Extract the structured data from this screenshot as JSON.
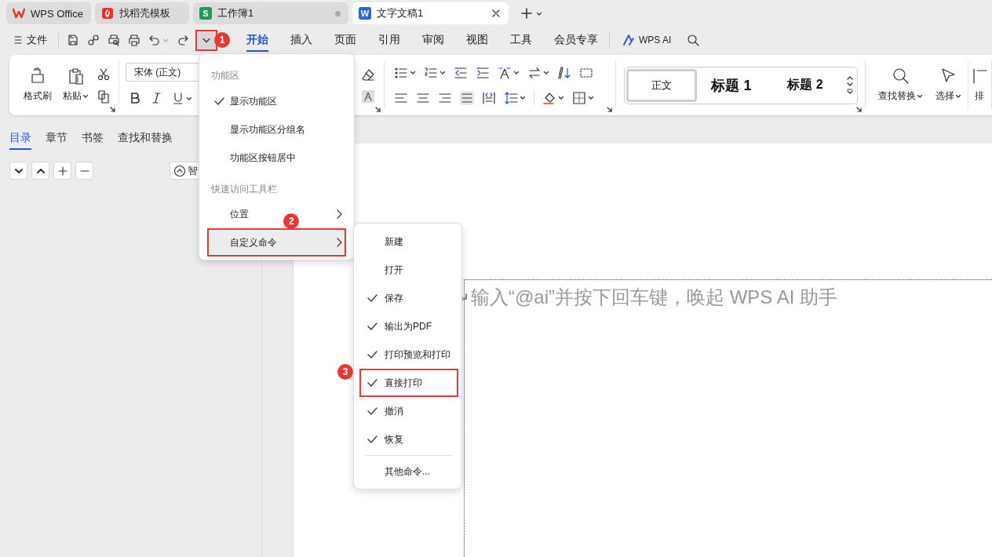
{
  "tabs": [
    {
      "kind": "home",
      "label": "WPS Office",
      "selected": false,
      "modified": false
    },
    {
      "kind": "template",
      "label": "找稻壳模板",
      "selected": false,
      "modified": false
    },
    {
      "kind": "sheet",
      "icon_letter": "S",
      "label": "工作簿1",
      "selected": false,
      "modified": true
    },
    {
      "kind": "writer",
      "icon_letter": "W",
      "label": "文字文稿1",
      "selected": true,
      "modified": false
    }
  ],
  "quick_access": {
    "file_label": "文件",
    "callout": "1"
  },
  "ribbon_tabs": [
    {
      "label": "开始",
      "selected": true
    },
    {
      "label": "插入",
      "selected": false
    },
    {
      "label": "页面",
      "selected": false
    },
    {
      "label": "引用",
      "selected": false
    },
    {
      "label": "审阅",
      "selected": false
    },
    {
      "label": "视图",
      "selected": false
    },
    {
      "label": "工具",
      "selected": false
    },
    {
      "label": "会员专享",
      "selected": false
    }
  ],
  "ai_button": "WPS AI",
  "ribbon": {
    "format_painter": "格式刷",
    "paste": "粘贴",
    "font": "宋体 (正文)",
    "styles": [
      {
        "label": "正文",
        "selected": true
      },
      {
        "label": "标题 1",
        "selected": false
      },
      {
        "label": "标题 2",
        "selected": false
      }
    ],
    "find_replace": "查找替换",
    "select": "选择",
    "layout": "排"
  },
  "nav": {
    "tabs": [
      {
        "label": "目录",
        "selected": true
      },
      {
        "label": "章节",
        "selected": false
      },
      {
        "label": "书签",
        "selected": false
      },
      {
        "label": "查找和替换",
        "selected": false
      }
    ],
    "smart_button": "智"
  },
  "document": {
    "placeholder": "输入“@ai”并按下回车键，唤起 WPS AI 助手"
  },
  "menu": {
    "sections": [
      {
        "title": "功能区",
        "items": [
          {
            "kind": "check",
            "label": "显示功能区",
            "checked": true
          },
          {
            "kind": "check",
            "label": "显示功能区分组名",
            "checked": false
          },
          {
            "kind": "check",
            "label": "功能区按钮居中",
            "checked": false
          }
        ]
      },
      {
        "title": "快速访问工具栏",
        "items": [
          {
            "kind": "submenu",
            "label": "位置",
            "highlighted": false
          },
          {
            "kind": "submenu",
            "label": "自定义命令",
            "highlighted": true,
            "callout": "2"
          }
        ]
      }
    ]
  },
  "submenu": {
    "items": [
      {
        "kind": "check",
        "label": "新建",
        "checked": false
      },
      {
        "kind": "check",
        "label": "打开",
        "checked": false
      },
      {
        "kind": "check",
        "label": "保存",
        "checked": true
      },
      {
        "kind": "check",
        "label": "输出为PDF",
        "checked": true
      },
      {
        "kind": "check",
        "label": "打印预览和打印",
        "checked": true
      },
      {
        "kind": "check",
        "label": "直接打印",
        "checked": true,
        "callout": "3"
      },
      {
        "kind": "check",
        "label": "撤消",
        "checked": true
      },
      {
        "kind": "check",
        "label": "恢复",
        "checked": true
      },
      {
        "kind": "separator"
      },
      {
        "kind": "command",
        "label": "其他命令..."
      }
    ]
  }
}
